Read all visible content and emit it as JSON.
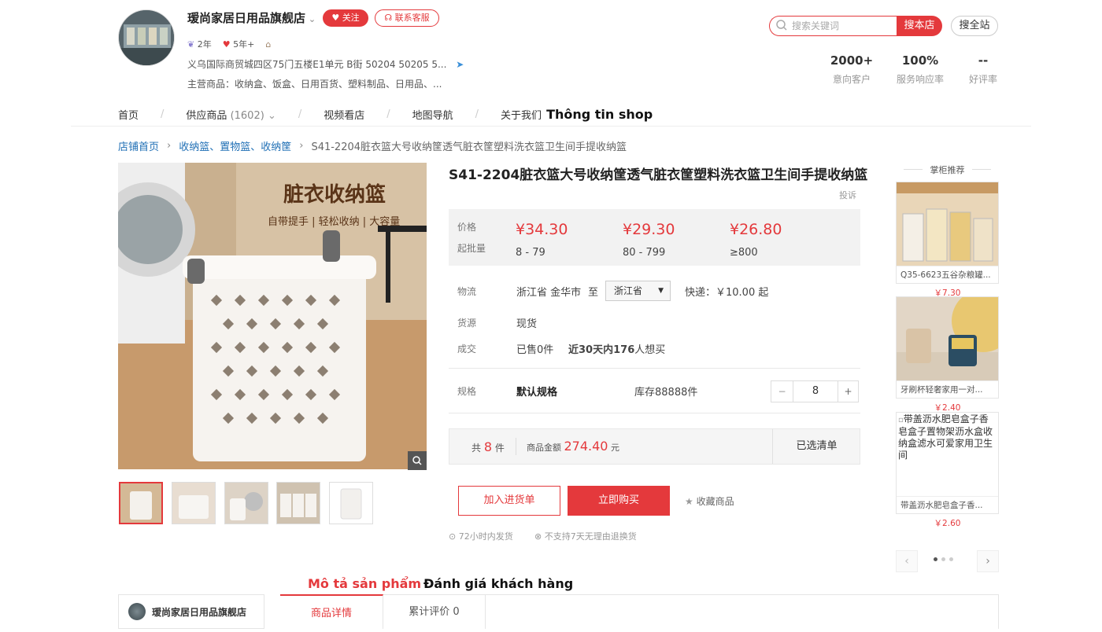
{
  "colors": {
    "accent": "#e4393c",
    "link": "#1f6fb5"
  },
  "shop": {
    "name": "瑷尚家居日用品旗舰店",
    "follow_label": "关注",
    "contact_label": "联系客服",
    "badge_years": "2年",
    "badge_rating": "5年+",
    "address": "义乌国际商贸城四区75门五楼E1单元 B街 50204 50205 5...",
    "main_business": "主营商品：收纳盒、饭盒、日用百货、塑料制品、日用品、..."
  },
  "search": {
    "placeholder": "搜索关键词",
    "store_button": "搜本店",
    "all_button": "搜全站"
  },
  "stats": [
    {
      "value": "2000+",
      "label": "意向客户"
    },
    {
      "value": "100%",
      "label": "服务响应率"
    },
    {
      "value": "--",
      "label": "好评率"
    }
  ],
  "nav": {
    "home": "首页",
    "supply": "供应商品",
    "supply_count": "(1602)",
    "video": "视频看店",
    "map": "地图导航",
    "about": "关于我们",
    "annotation": "Thông tin shop"
  },
  "breadcrumb": {
    "home": "店铺首页",
    "category": "收纳篮、置物篮、收纳筐",
    "current": "S41-2204脏衣篮大号收纳筐透气脏衣筐塑料洗衣篮卫生间手提收纳篮"
  },
  "product": {
    "image_headline": "脏衣收纳篮",
    "image_subline": "自带提手 | 轻松收纳 | 大容量",
    "title": "S41-2204脏衣篮大号收纳筐透气脏衣筐塑料洗衣篮卫生间手提收纳篮",
    "report": "投诉",
    "price_label": "价格",
    "moq_label": "起批量",
    "prices": [
      {
        "price": "¥34.30",
        "range": "8 - 79"
      },
      {
        "price": "¥29.30",
        "range": "80 - 799"
      },
      {
        "price": "¥26.80",
        "range": "≥800"
      }
    ],
    "logistics_label": "物流",
    "ship_from": "浙江省 金华市",
    "to": "至",
    "dest_select": "浙江省",
    "express": "快递：￥10.00 起",
    "source_label": "货源",
    "source_value": "现货",
    "deal_label": "成交",
    "sold": "已售0件",
    "recent_prefix": "近",
    "recent_days": "30天内",
    "recent_count": "176",
    "recent_suffix": "人想买",
    "spec_label": "规格",
    "spec_value": "默认规格",
    "stock": "库存88888件",
    "qty_minus": "−",
    "qty": "8",
    "qty_plus": "+",
    "total_prefix": "共",
    "total_count": "8",
    "total_unit": "件",
    "amount_label": "商品金额",
    "amount": "274.40",
    "amount_unit": "元",
    "selected_list": "已选清单",
    "add_cart": "加入进货单",
    "buy_now": "立即购买",
    "favorite": "收藏商品",
    "service1": "72小时内发货",
    "service2": "不支持7天无理由退换货"
  },
  "recommend": {
    "title": "掌柜推荐",
    "items": [
      {
        "name": "Q35-6623五谷杂粮罐...",
        "price": "￥7.30"
      },
      {
        "name": "牙刷杯轻奢家用一对...",
        "price": "￥2.40"
      },
      {
        "alt": "带盖沥水肥皂盒子香皂盒子置物架沥水盒收纳盒滤水可爱家用卫生间",
        "name": "带盖沥水肥皂盒子香...",
        "price": "￥2.60"
      }
    ],
    "prev": "‹",
    "next": "›"
  },
  "bottom": {
    "store_name": "瑷尚家居日用品旗舰店",
    "tab_detail": "商品详情",
    "tab_reviews": "累计评价 0",
    "annotation_desc": "Mô tả sản phẩm",
    "annotation_reviews": "Đánh giá khách hàng"
  }
}
